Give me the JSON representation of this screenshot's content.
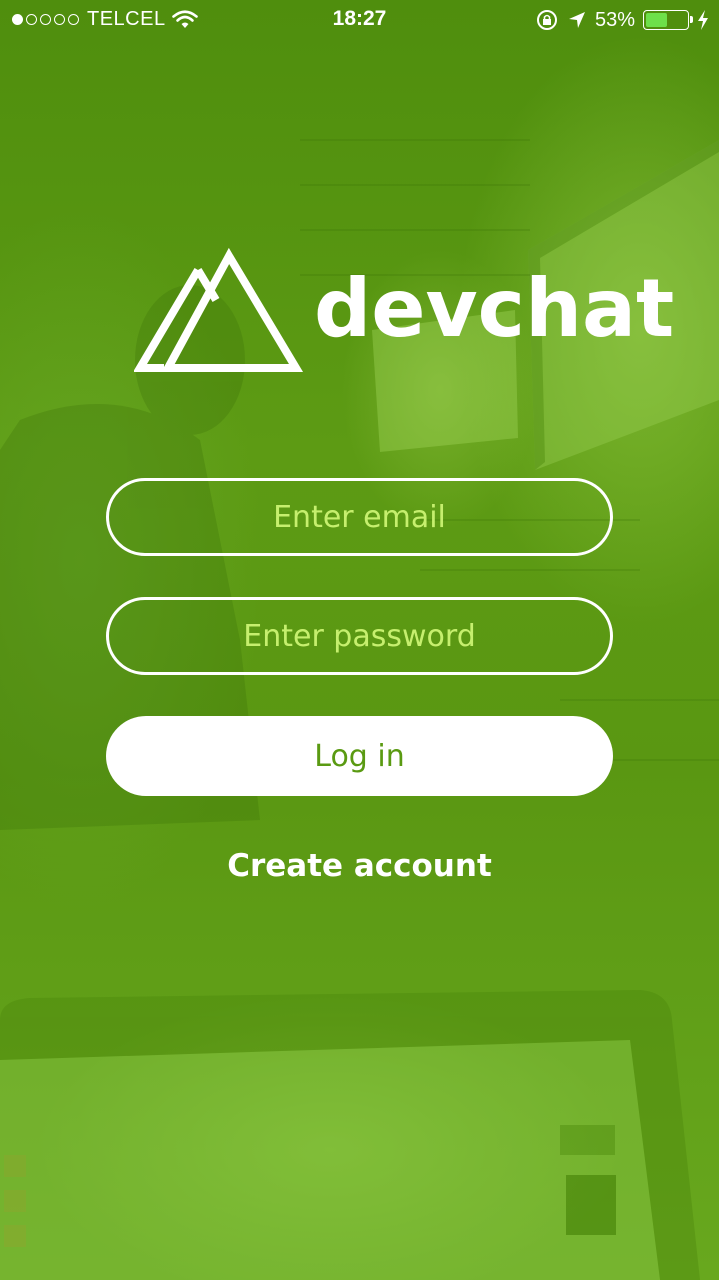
{
  "status_bar": {
    "carrier": "TELCEL",
    "time": "18:27",
    "battery_percent": "53%",
    "battery_level": 0.53,
    "signal_bars_filled": 1,
    "signal_bars_total": 5,
    "icons": [
      "wifi-icon",
      "rotation-lock-icon",
      "location-arrow-icon",
      "battery-icon",
      "charging-bolt-icon"
    ]
  },
  "logo": {
    "name": "devchat",
    "icon": "mountain-logo-icon"
  },
  "form": {
    "email_placeholder": "Enter email",
    "password_placeholder": "Enter password",
    "login_label": "Log in",
    "create_account_label": "Create account"
  },
  "colors": {
    "brand_green": "#5a9a12",
    "placeholder_green": "#c6ef6e",
    "white": "#ffffff"
  }
}
